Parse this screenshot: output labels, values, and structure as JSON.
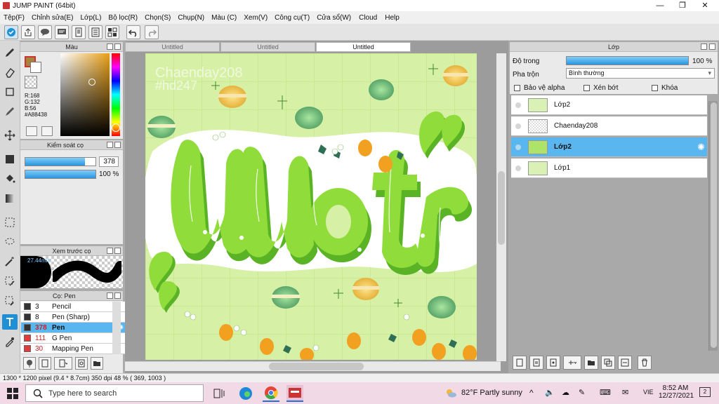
{
  "window": {
    "title": "JUMP PAINT (64bit)",
    "minimize": "—",
    "restore": "❐",
    "close": "✕"
  },
  "menu": [
    "Tệp(F)",
    "Chỉnh sửa(E)",
    "Lớp(L)",
    "Bộ lọc(R)",
    "Chọn(S)",
    "Chụp(N)",
    "Màu (C)",
    "Xem(V)",
    "Công cụ(T)",
    "Cửa sổ(W)",
    "Cloud",
    "Help"
  ],
  "color_panel": {
    "title": "Màu",
    "current_color": "#A88438",
    "r": "R:168",
    "g": "G:132",
    "b": "B:56",
    "hex": "#A88438"
  },
  "brush_control": {
    "title": "Kiểm soát cọ",
    "size_value": "378",
    "opacity_value": "100 %",
    "size_fraction": 0.85,
    "opacity_fraction": 1.0
  },
  "brush_preview": {
    "title": "Xem trước cọ",
    "size_label": "27.44mm"
  },
  "brush_list": {
    "title": "Cọ: Pen",
    "items": [
      {
        "size": "3",
        "name": "Pencil",
        "color": "#333333"
      },
      {
        "size": "8",
        "name": "Pen (Sharp)",
        "color": "#333333"
      },
      {
        "size": "378",
        "name": "Pen",
        "color": "#333333",
        "selected": true
      },
      {
        "size": "111",
        "name": "G Pen",
        "color": "#e33b3b"
      },
      {
        "size": "30",
        "name": "Mapping Pen",
        "color": "#e33b3b"
      }
    ]
  },
  "doc_tabs": [
    "Untitled",
    "Untitled",
    "Untitled"
  ],
  "artwork": {
    "watermark_line1": "Chaenday208",
    "watermark_line2": "#hd247",
    "title_text": "Uoor",
    "bg_color": "#d6f0a6",
    "letter_color": "#8fdc3a"
  },
  "layer_panel": {
    "title": "Lớp",
    "opacity_label": "Độ trong",
    "opacity_value": "100 %",
    "opacity_fraction": 1.0,
    "blend_label": "Pha trộn",
    "blend_value": "Bình thường",
    "protect_alpha": "Bảo vệ alpha",
    "clip": "Xén bớt",
    "lock": "Khóa",
    "layers": [
      {
        "name": "Lớp2",
        "selected": false
      },
      {
        "name": "Chaenday208",
        "selected": false
      },
      {
        "name": "Lớp2",
        "selected": true
      },
      {
        "name": "Lớp1",
        "selected": false
      }
    ]
  },
  "status": {
    "text": "1300 * 1200 pixel  (9.4 * 8.7cm)  350 dpi  48 %  ( 369, 1003 )"
  },
  "taskbar": {
    "search_placeholder": "Type here to search",
    "weather": "82°F  Partly sunny",
    "lang": "VIE",
    "time": "8:52 AM",
    "date": "12/27/2021",
    "notif_count": "2"
  }
}
